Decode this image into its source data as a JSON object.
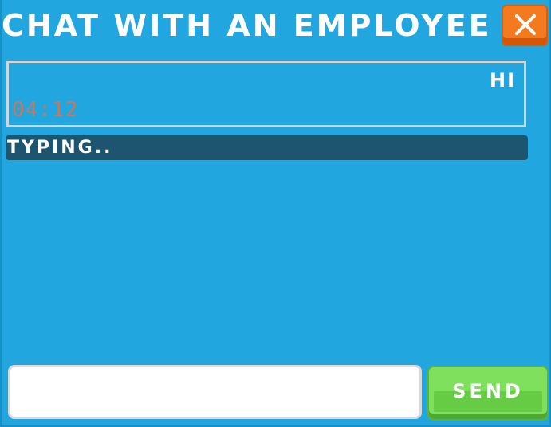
{
  "window": {
    "title": "CHAT WITH AN EMPLOYEE"
  },
  "close_button": {
    "icon": "close-icon"
  },
  "messages": [
    {
      "text": "HI",
      "time": "04:12"
    }
  ],
  "status": {
    "typing_text": "TYPING.."
  },
  "composer": {
    "input_value": "",
    "input_placeholder": "",
    "send_label": "SEND"
  },
  "colors": {
    "background": "#22a6e0",
    "close_button": "#f47a1f",
    "send_button": "#7fe05e",
    "typing_bar": "#1d5570",
    "timestamp": "#c9785a"
  }
}
